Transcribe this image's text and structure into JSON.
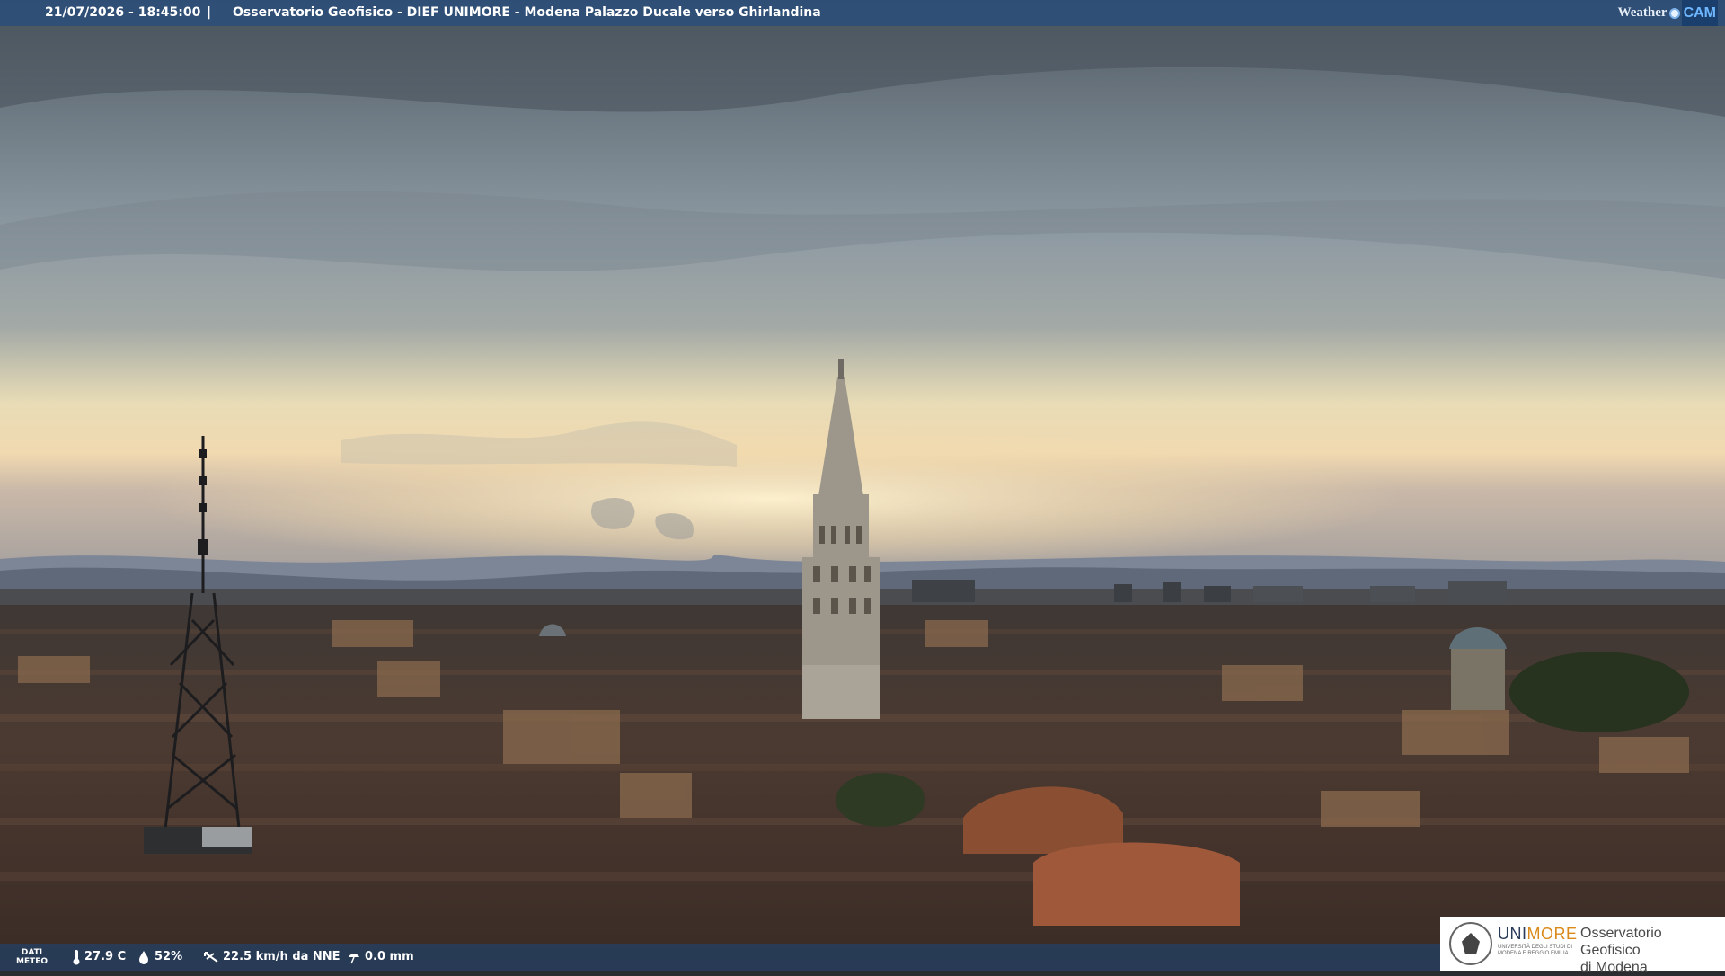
{
  "overlay": {
    "datetime": "21/07/2026 - 18:45:00",
    "separator": "|",
    "title": "Osservatorio Geofisico - DIEF UNIMORE - Modena Palazzo Ducale verso Ghirlandina",
    "brand": {
      "weather": "Weather",
      "cam": "CAM"
    }
  },
  "weather": {
    "label_line1": "DATI",
    "label_line2": "METEO",
    "temperature": "27.9 C",
    "humidity": "52%",
    "wind": "22.5 km/h da NNE",
    "rain": "0.0 mm"
  },
  "logo": {
    "uni_a": "UNI",
    "uni_b": "MORE",
    "uni_sub": "UNIVERSITÀ DEGLI STUDI DI MODENA E REGGIO EMILIA",
    "obs_line1": "Osservatorio Geofisico",
    "obs_line2": "di Modena"
  },
  "colors": {
    "sky_top": "#5d6770",
    "sky_mid": "#8f9aa2",
    "horizon_glow": "#f4e4b8",
    "hills": "#5f6a7a",
    "roofs": "#4a3a33",
    "tower": "#a8a39a"
  }
}
